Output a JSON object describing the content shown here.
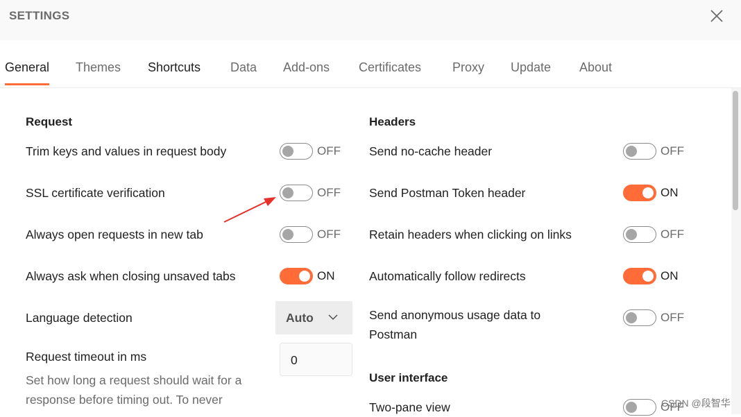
{
  "header": {
    "title": "SETTINGS",
    "close_icon": "close-icon"
  },
  "tabs": [
    {
      "label": "General",
      "active": true
    },
    {
      "label": "Themes"
    },
    {
      "label": "Shortcuts"
    },
    {
      "label": "Data"
    },
    {
      "label": "Add-ons"
    },
    {
      "label": "Certificates"
    },
    {
      "label": "Proxy"
    },
    {
      "label": "Update"
    },
    {
      "label": "About"
    }
  ],
  "request": {
    "heading": "Request",
    "trim": {
      "label": "Trim keys and values in request body",
      "state": "OFF"
    },
    "ssl": {
      "label": "SSL certificate verification",
      "state": "OFF"
    },
    "newtab": {
      "label": "Always open requests in new tab",
      "state": "OFF"
    },
    "ask": {
      "label": "Always ask when closing unsaved tabs",
      "state": "ON"
    },
    "lang": {
      "label": "Language detection",
      "value": "Auto"
    },
    "timeout": {
      "label": "Request timeout in ms",
      "value": "0",
      "desc": "Set how long a request should wait for a response before timing out. To never"
    }
  },
  "headers": {
    "heading": "Headers",
    "nocache": {
      "label": "Send no-cache header",
      "state": "OFF"
    },
    "token": {
      "label": "Send Postman Token header",
      "state": "ON"
    },
    "retain": {
      "label": "Retain headers when clicking on links",
      "state": "OFF"
    },
    "redirects": {
      "label": "Automatically follow redirects",
      "state": "ON"
    },
    "anon": {
      "label": "Send anonymous usage data to Postman",
      "state": "OFF"
    }
  },
  "ui": {
    "heading": "User interface",
    "twopane": {
      "label": "Two-pane view",
      "state": "OFF"
    }
  },
  "watermark": "CSDN @段智华",
  "colors": {
    "accent": "#ff6c37",
    "annotation_arrow": "#e8302a"
  }
}
